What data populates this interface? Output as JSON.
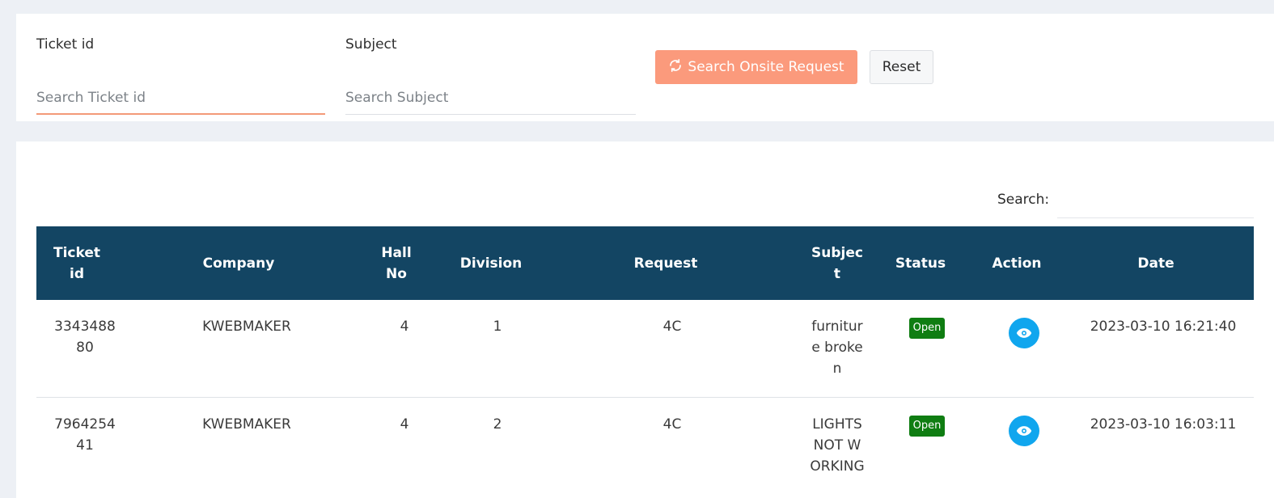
{
  "filters": {
    "ticket_label": "Ticket id",
    "ticket_placeholder": "Search Ticket id",
    "subject_label": "Subject",
    "subject_placeholder": "Search Subject",
    "search_button": "Search Onsite Request",
    "reset_button": "Reset"
  },
  "table": {
    "search_label": "Search:",
    "headers": {
      "ticket_id": "Ticket id",
      "company": "Company",
      "hall_no": "Hall No",
      "division": "Division",
      "request": "Request",
      "subject": "Subject",
      "status": "Status",
      "action": "Action",
      "date": "Date"
    },
    "rows": [
      {
        "ticket_id": "334348880",
        "company": "KWEBMAKER",
        "hall_no": "4",
        "division": "1",
        "request": "4C",
        "subject": "furniture broken",
        "status": "Open",
        "date": "2023-03-10 16:21:40"
      },
      {
        "ticket_id": "796425441",
        "company": "KWEBMAKER",
        "hall_no": "4",
        "division": "2",
        "request": "4C",
        "subject": "LIGHTS NOT WORKING",
        "status": "Open",
        "date": "2023-03-10 16:03:11"
      }
    ]
  },
  "colors": {
    "header_bg": "#134563",
    "search_button_bg": "#fb9a7c",
    "status_open_bg": "#0f7d12",
    "action_button_bg": "#10a6ee"
  },
  "icons": {
    "search_button_icon": "refresh-icon",
    "action_icon": "eye-icon"
  }
}
